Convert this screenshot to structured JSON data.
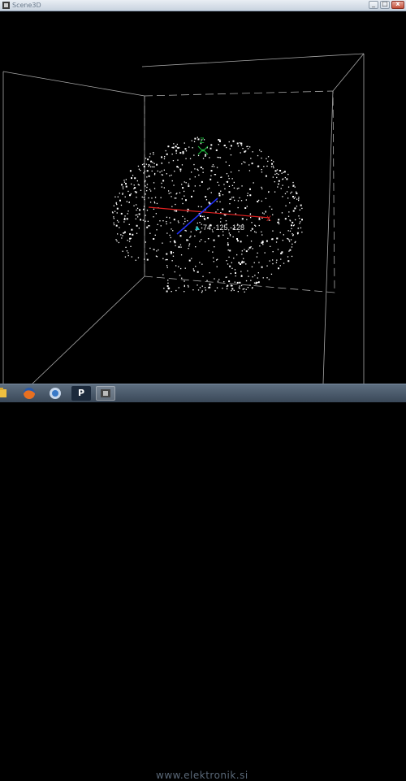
{
  "window": {
    "title": "Scene3D"
  },
  "window_buttons": {
    "minimize": "_",
    "maximize": "□",
    "close": "x"
  },
  "scene": {
    "axis_z_label": "Z",
    "axis_x_label": "X",
    "coordinate_readout": "74,-125,-128",
    "colors": {
      "x_axis": "#e02020",
      "y_axis": "#2030ff",
      "z_axis": "#20c040",
      "points": "#ffffff",
      "box": "#b0b0b0"
    }
  },
  "taskbar": {
    "items": [
      {
        "name": "folder-icon",
        "glyph": "",
        "color": "#f0c040"
      },
      {
        "name": "firefox-icon",
        "glyph": "",
        "color": "#e87020"
      },
      {
        "name": "app-icon",
        "glyph": "",
        "color": "#3a7ac8"
      },
      {
        "name": "p-app-icon",
        "glyph": "P",
        "color": "#ffffff"
      },
      {
        "name": "scene3d-taskbar-icon",
        "glyph": "",
        "color": "#888888"
      }
    ],
    "watermark": "www.elektronik.si"
  }
}
